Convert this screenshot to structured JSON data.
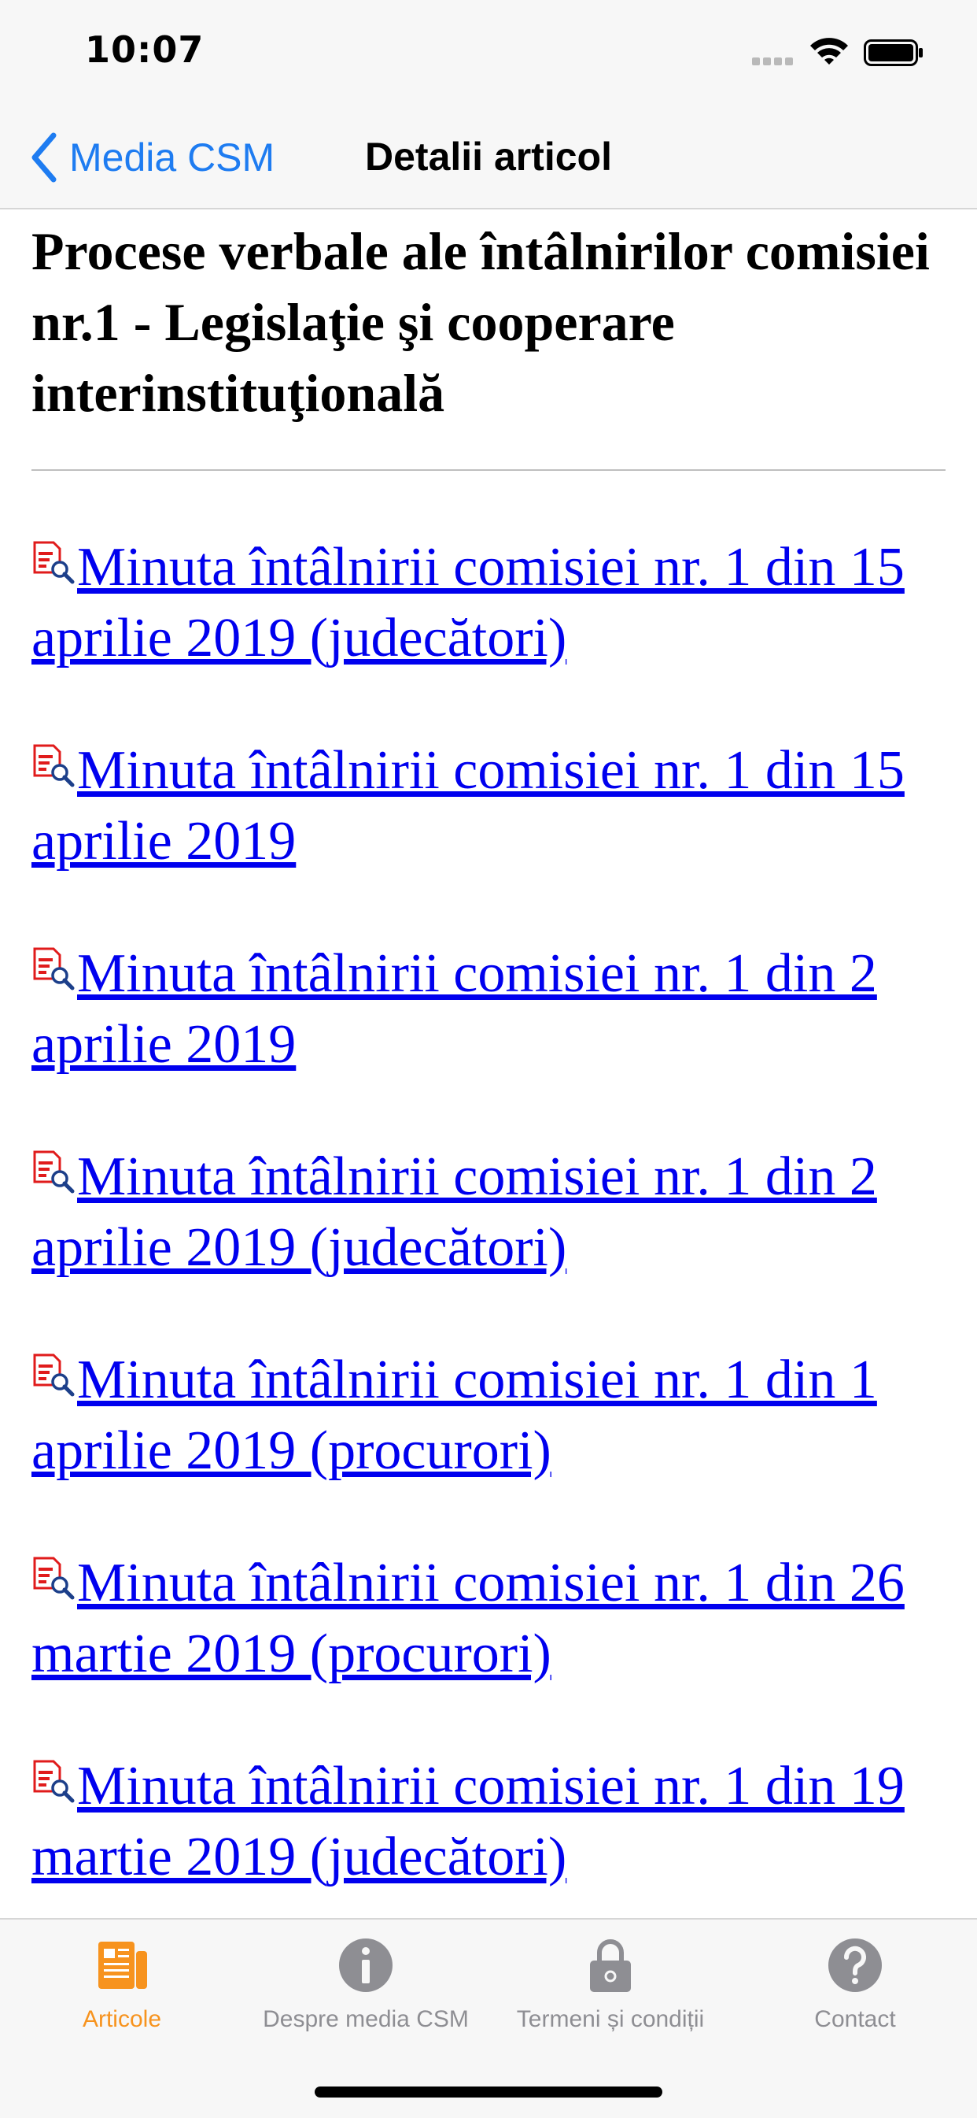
{
  "status_bar": {
    "time": "10:07"
  },
  "nav": {
    "back_label": "Media CSM",
    "title": "Detalii articol"
  },
  "article": {
    "title": "Procese verbale ale întâlnirilor comisiei nr.1 - Legislaţie şi cooperare interinstituţională",
    "documents": [
      {
        "label": "Minuta întâlnirii comisiei nr. 1 din 15 aprilie 2019 (judecători)"
      },
      {
        "label": "Minuta întâlnirii comisiei nr. 1 din 15 aprilie 2019"
      },
      {
        "label": "Minuta întâlnirii comisiei nr. 1 din 2 aprilie 2019"
      },
      {
        "label": "Minuta întâlnirii comisiei nr. 1 din 2 aprilie 2019 (judecători)"
      },
      {
        "label": "Minuta întâlnirii comisiei nr. 1 din 1 aprilie 2019 (procurori)"
      },
      {
        "label": "Minuta întâlnirii comisiei nr. 1 din 26 martie 2019 (procurori)"
      },
      {
        "label": "Minuta întâlnirii comisiei nr. 1 din 19 martie 2019 (judecători)"
      }
    ],
    "document_icon": "pdf-document-search-icon"
  },
  "tabs": [
    {
      "label": "Articole",
      "icon": "articles-icon",
      "active": true
    },
    {
      "label": "Despre media CSM",
      "icon": "info-icon",
      "active": false
    },
    {
      "label": "Termeni și condiții",
      "icon": "lock-icon",
      "active": false
    },
    {
      "label": "Contact",
      "icon": "question-icon",
      "active": false
    }
  ],
  "colors": {
    "accent": "#f7931e",
    "link": "#0000ee",
    "nav_tint": "#1e7cf1",
    "inactive_tab": "#8e8e93"
  }
}
